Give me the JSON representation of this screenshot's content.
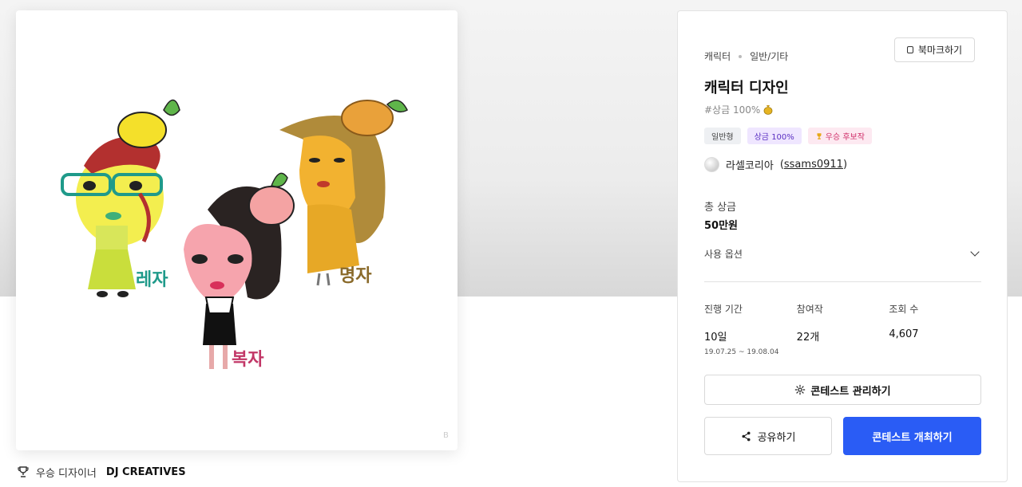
{
  "artwork": {
    "labels": [
      "레자",
      "복자",
      "명자"
    ],
    "corner_mark": "B"
  },
  "winner": {
    "prefix": "우승 디자이너",
    "name": "DJ CREATIVES"
  },
  "panel": {
    "breadcrumb": [
      "캐릭터",
      "일반/기타"
    ],
    "bookmark_label": "북마크하기",
    "title": "캐릭터 디자인",
    "prize_tag": "#상금 100%",
    "badges": [
      {
        "label": "일반형",
        "style": "gray"
      },
      {
        "label": "상금 100%",
        "style": "purple"
      },
      {
        "label": "우승 후보작",
        "style": "pink"
      }
    ],
    "host": {
      "name": "라셀코리아",
      "id": "ssams0911"
    },
    "total_prize": {
      "label": "총 상금",
      "value": "50만원"
    },
    "options_label": "사용 옵션",
    "stats": [
      {
        "label": "진행 기간",
        "value": "10일",
        "sub": "19.07.25 ~ 19.08.04"
      },
      {
        "label": "참여작",
        "value": "22개",
        "sub": ""
      },
      {
        "label": "조회 수",
        "value": "4,607",
        "sub": ""
      }
    ],
    "manage_label": "콘테스트 관리하기",
    "share_label": "공유하기",
    "host_contest_label": "콘테스트 개최하기"
  },
  "colors": {
    "primary": "#2a5cf5",
    "badge_purple_bg": "#efe6ff",
    "badge_pink_bg": "#fde9f1"
  }
}
